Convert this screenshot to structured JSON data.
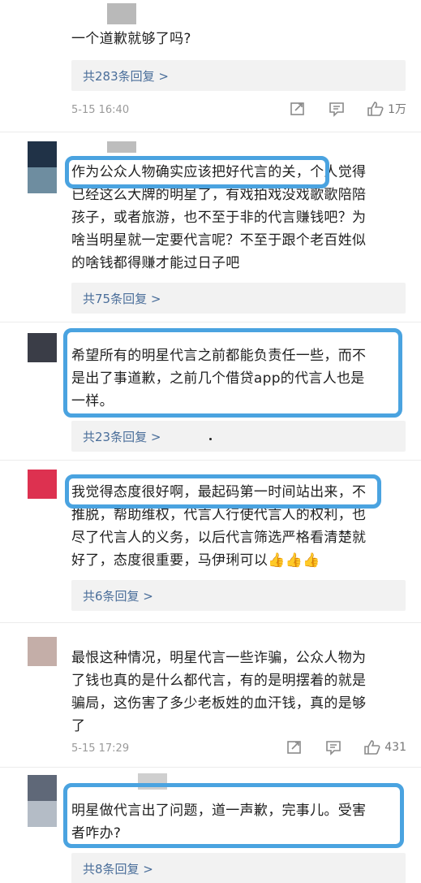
{
  "comments": [
    {
      "text_lines": [
        "一个道歉就够了吗?"
      ],
      "reply_label": "共283条回复 >",
      "time": "5-15 16:40",
      "likes": "1万"
    },
    {
      "text_lines": [
        "作为公众人物确实应该把好代言的关，个人觉得",
        "已经这么大牌的明星了，有戏拍戏没戏歌歌陪陪",
        "孩子，或者旅游，也不至于非的代言赚钱吧？为",
        "啥当明星就一定要代言呢？不至于跟个老百姓似",
        "的啥钱都得赚才能过日子吧"
      ],
      "reply_label": "共75条回复 >"
    },
    {
      "text_lines": [
        "希望所有的明星代言之前都能负责任一些，而不",
        "是出了事道歉，之前几个借贷app的代言人也是",
        "一样。"
      ],
      "reply_label": "共23条回复 >"
    },
    {
      "text_lines": [
        "我觉得态度很好啊，最起码第一时间站出来，不",
        "推脱，帮助维权，代言人行使代言人的权利，也",
        "尽了代言人的义务，以后代言筛选严格看清楚就",
        "好了，态度很重要，马伊琍可以👍👍👍"
      ],
      "reply_label": "共6条回复 >"
    },
    {
      "text_lines": [
        "最恨这种情况，明星代言一些诈骗，公众人物为",
        "了钱也真的是什么都代言，有的是明摆着的就是",
        "骗局，这伤害了多少老板姓的血汗钱，真的是够",
        "了"
      ],
      "time": "5-15 17:29",
      "likes": "431"
    },
    {
      "text_lines": [
        "明星做代言出了问题，道一声歉，完事儿。受害",
        "者咋办?"
      ],
      "reply_label": "共8条回复 >"
    }
  ],
  "colors": {
    "highlight": "#4aa3e0",
    "reply_link": "#4a6e9a",
    "reply_bg": "#f2f2f2"
  },
  "icons": [
    "share-icon",
    "comment-icon",
    "like-icon"
  ]
}
